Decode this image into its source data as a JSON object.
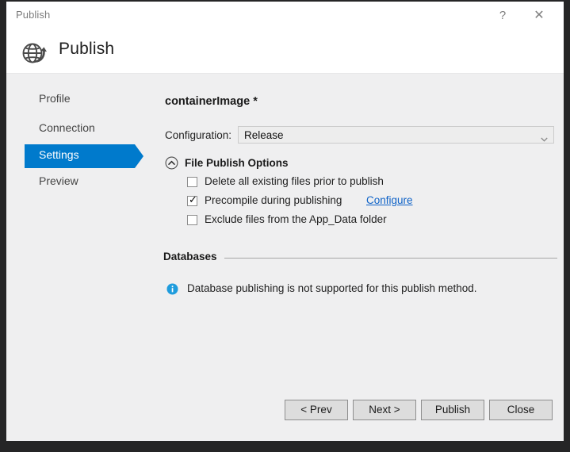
{
  "window": {
    "title": "Publish",
    "help_glyph": "?",
    "close_glyph": "✕",
    "accent_color": "#007acc",
    "body_background": "#efeff0",
    "titlebar_background": "#ffffff"
  },
  "header": {
    "title": "Publish",
    "icon": "globe-publish-icon"
  },
  "sidebar": {
    "items": [
      {
        "label": "Profile",
        "selected": false
      },
      {
        "label": "Connection",
        "selected": false
      },
      {
        "label": "Settings",
        "selected": true
      },
      {
        "label": "Preview",
        "selected": false
      }
    ]
  },
  "main": {
    "profile_title": "containerImage *",
    "configuration": {
      "label": "Configuration:",
      "value": "Release",
      "options": [
        "Release"
      ],
      "chevron_icon": "chevron-down-icon"
    },
    "file_publish_options": {
      "title": "File Publish Options",
      "expander_icon": "chevron-up-circle-icon",
      "expanded": true,
      "checkboxes": [
        {
          "label": "Delete all existing files prior to publish",
          "checked": false,
          "check_glyph": "✓"
        },
        {
          "label": "Precompile during publishing",
          "checked": true,
          "check_glyph": "✓"
        },
        {
          "label": "Exclude files from the App_Data folder",
          "checked": false,
          "check_glyph": "✓"
        }
      ],
      "configure_link": "Configure",
      "link_color": "#0e62c7"
    },
    "databases": {
      "title": "Databases",
      "info_icon": "info-circle-icon",
      "info_icon_color": "#1f9cdd",
      "info_message": "Database publishing is not supported for this publish method."
    }
  },
  "footer": {
    "buttons": [
      {
        "label": "< Prev"
      },
      {
        "label": "Next >"
      },
      {
        "label": "Publish"
      },
      {
        "label": "Close"
      }
    ]
  }
}
